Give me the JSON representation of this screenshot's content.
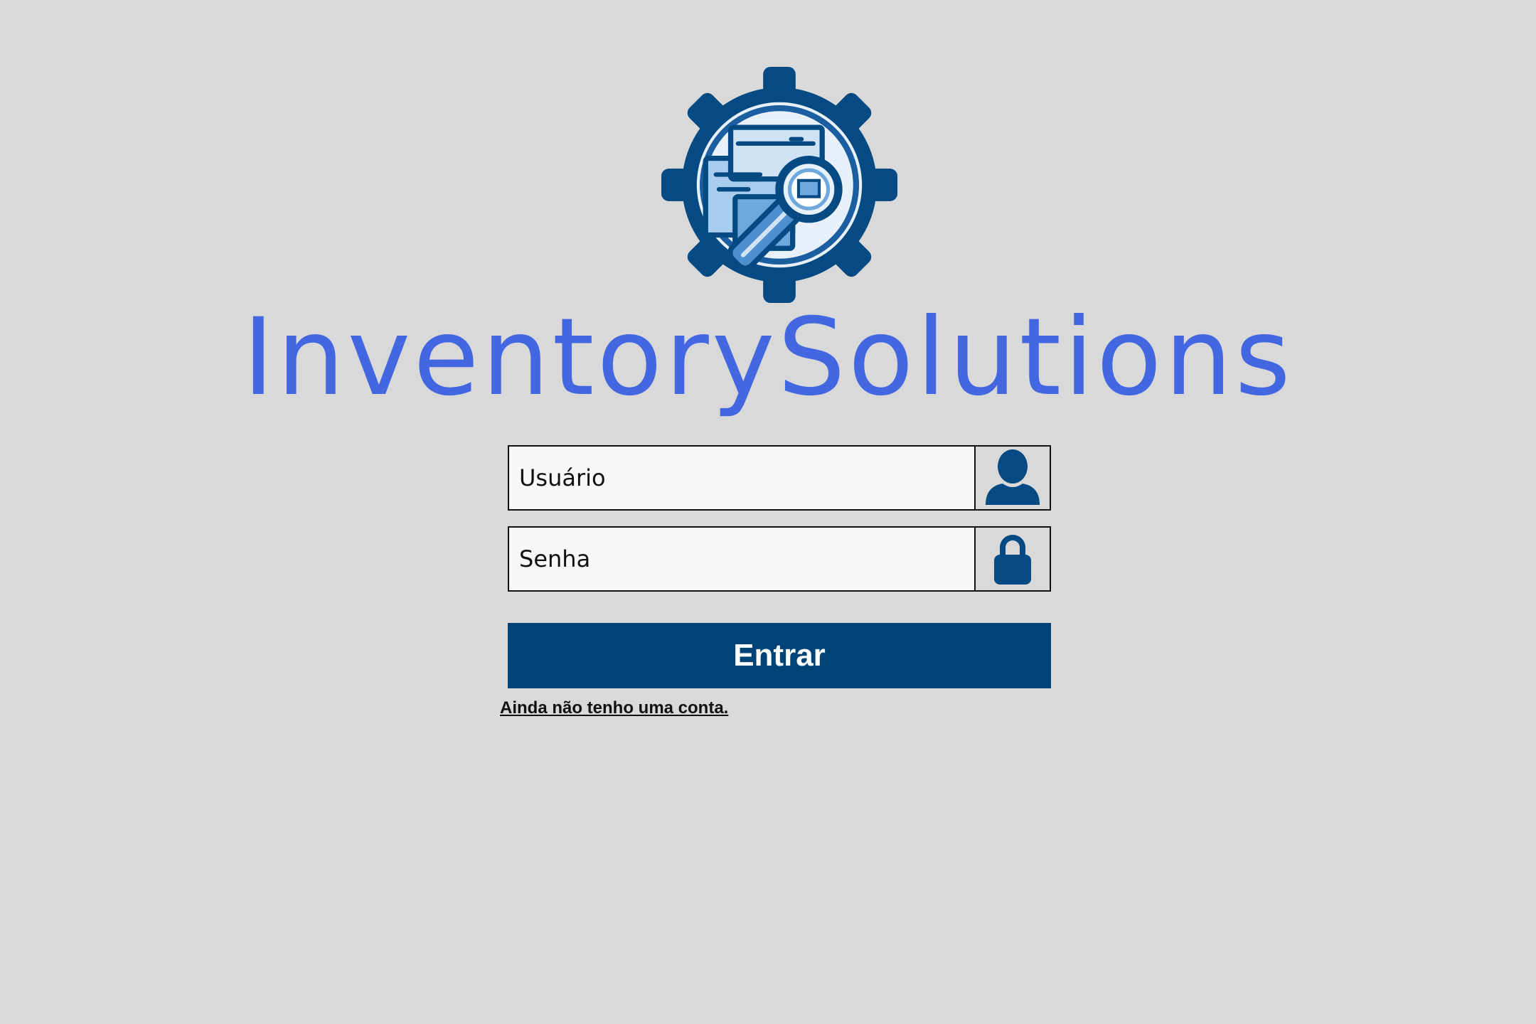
{
  "brand": {
    "title": "InventorySolutions",
    "logo_icon": "gear-magnifier-inventory-icon"
  },
  "login": {
    "username": {
      "value": "",
      "placeholder": "Usuário",
      "icon": "user-icon"
    },
    "password": {
      "value": "",
      "placeholder": "Senha",
      "icon": "lock-icon"
    },
    "submit_label": "Entrar",
    "signup_link": "Ainda não tenho uma conta."
  },
  "colors": {
    "background": "#d9d9d9",
    "brand_blue": "#4267e1",
    "primary_dark": "#004477",
    "input_bg": "#f8f8f8",
    "border": "#111111"
  }
}
